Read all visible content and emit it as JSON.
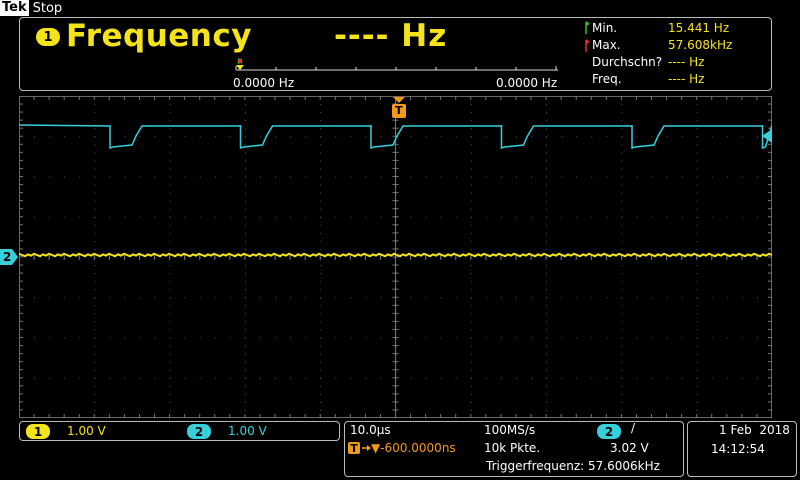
{
  "brand": {
    "logo": "Tek",
    "state": "Stop"
  },
  "measurement": {
    "channel": "1",
    "title": "Frequency",
    "value": "---- Hz",
    "stats": [
      {
        "label": "Min.",
        "value": "15.441 Hz"
      },
      {
        "label": "Max.",
        "value": "57.608kHz"
      },
      {
        "label": "Durchschn?",
        "value": "---- Hz"
      },
      {
        "label": "Freq.",
        "value": "---- Hz"
      }
    ],
    "range_left": "0.0000 Hz",
    "range_right": "0.0000 Hz"
  },
  "channels": [
    {
      "id": "1",
      "scale": "1.00 V",
      "color": "#f5e31a"
    },
    {
      "id": "2",
      "scale": "1.00 V",
      "color": "#36d0dc"
    }
  ],
  "markers": {
    "ch2": "2",
    "trigger": "T"
  },
  "timebase": {
    "scale": "10.0µs",
    "sample_rate": "100MS/s",
    "position": "▼-600.0000ns",
    "record_length": "10k Pkte.",
    "trigger_channel": "2",
    "trigger_slope": "/",
    "trigger_level": "3.02 V",
    "trigger_frequency": "Triggerfrequenz: 57.6006kHz"
  },
  "clock": {
    "date": "1 Feb  2018",
    "time": "14:12:54"
  },
  "colors": {
    "ch1": "#f5e31a",
    "ch2": "#36d0dc",
    "trigger": "#f29a1a"
  }
}
